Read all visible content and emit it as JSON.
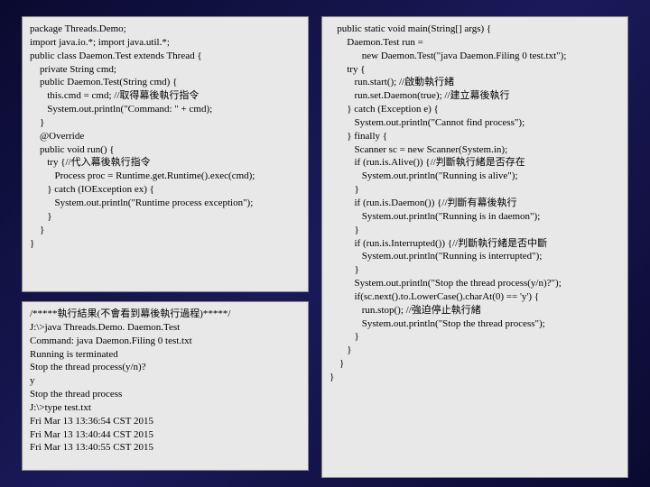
{
  "left_top": "package Threads.Demo;\nimport java.io.*; import java.util.*;\npublic class Daemon.Test extends Thread {\n    private String cmd;\n    public Daemon.Test(String cmd) {\n       this.cmd = cmd; //取得幕後執行指令\n       System.out.println(\"Command: \" + cmd);\n    }\n    @Override\n    public void run() {\n       try {//代入幕後執行指令\n          Process proc = Runtime.get.Runtime().exec(cmd);\n       } catch (IOException ex) {\n          System.out.println(\"Runtime process exception\");\n       }\n    }\n}",
  "left_bottom": "/*****執行結果(不會看到幕後執行過程)*****/\nJ:\\>java Threads.Demo. Daemon.Test\nCommand: java Daemon.Filing 0 test.txt\nRunning is terminated\nStop the thread process(y/n)?\ny\nStop the thread process\nJ:\\>type test.txt\nFri Mar 13 13:36:54 CST 2015\nFri Mar 13 13:40:44 CST 2015\nFri Mar 13 13:40:55 CST 2015",
  "right": "   public static void main(String[] args) {\n       Daemon.Test run =\n             new Daemon.Test(\"java Daemon.Filing 0 test.txt\");\n       try {\n          run.start(); //啟動執行緒\n          run.set.Daemon(true); //建立幕後執行\n       } catch (Exception e) {\n          System.out.println(\"Cannot find process\");\n       } finally {\n          Scanner sc = new Scanner(System.in);\n          if (run.is.Alive()) {//判斷執行緒是否存在\n             System.out.println(\"Running is alive\");\n          }\n          if (run.is.Daemon()) {//判斷有幕後執行\n             System.out.println(\"Running is in daemon\");\n          }\n          if (run.is.Interrupted()) {//判斷執行緒是否中斷\n             System.out.println(\"Running is interrupted\");\n          }\n          System.out.println(\"Stop the thread process(y/n)?\");\n          if(sc.next().to.LowerCase().charAt(0) == 'y') {\n             run.stop(); //強迫停止執行緒\n             System.out.println(\"Stop the thread process\");\n          }\n       }\n    }\n}"
}
